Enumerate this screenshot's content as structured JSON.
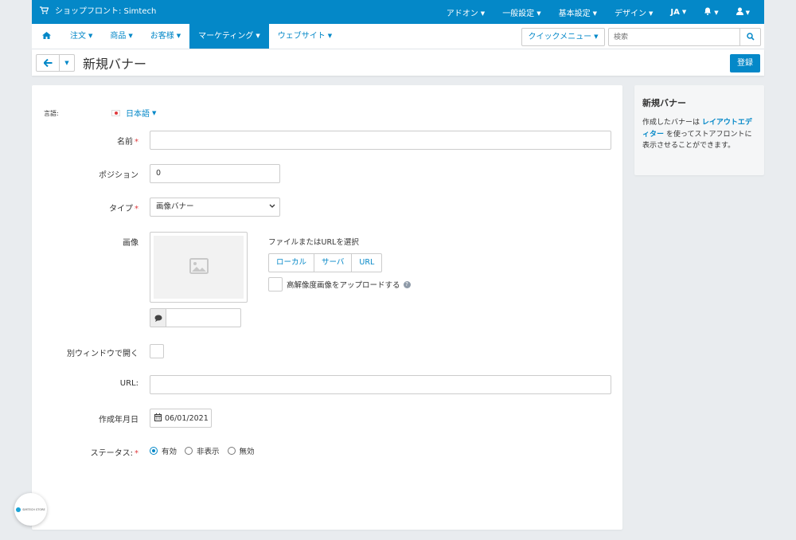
{
  "topbar": {
    "store_label": "ショップフロント: Simtech",
    "menu": [
      "アドオン",
      "一般設定",
      "基本設定",
      "デザイン",
      "JA"
    ]
  },
  "nav": {
    "items": [
      "注文",
      "商品",
      "お客様",
      "マーケティング",
      "ウェブサイト"
    ],
    "active_index": 3,
    "quick_menu": "クイックメニュー",
    "search_placeholder": "検索"
  },
  "page": {
    "title": "新規バナー",
    "save_label": "登録"
  },
  "form": {
    "language_label": "言語:",
    "language_value": "日本語",
    "name_label": "名前",
    "name_value": "",
    "position_label": "ポジション",
    "position_value": "0",
    "type_label": "タイプ",
    "type_value": "画像バナー",
    "image_label": "画像",
    "file_title": "ファイルまたはURLを選択",
    "sources": [
      "ローカル",
      "サーバ",
      "URL"
    ],
    "hires_label": "高解像度画像をアップロードする",
    "new_window_label": "別ウィンドウで開く",
    "url_label": "URL:",
    "url_value": "",
    "date_label": "作成年月日",
    "date_value": "06/01/2021",
    "status_label": "ステータス:",
    "status_options": [
      "有効",
      "非表示",
      "無効"
    ],
    "status_selected": 0
  },
  "sidebar": {
    "title": "新規バナー",
    "text_before": "作成したバナーは",
    "link": "レイアウトエディター",
    "text_after": "を使ってストアフロントに表示させることができます。"
  },
  "badge": {
    "text": "SIMTECH STORE"
  },
  "colors": {
    "accent": "#0488c8",
    "required": "#e03a3e",
    "background": "#e9ecef"
  },
  "icons": [
    "cart-icon",
    "bell-icon",
    "user-icon",
    "home-icon",
    "search-icon",
    "arrow-left-icon",
    "image-placeholder-icon",
    "comment-icon",
    "calendar-icon",
    "question-icon",
    "flag-japan-icon"
  ]
}
